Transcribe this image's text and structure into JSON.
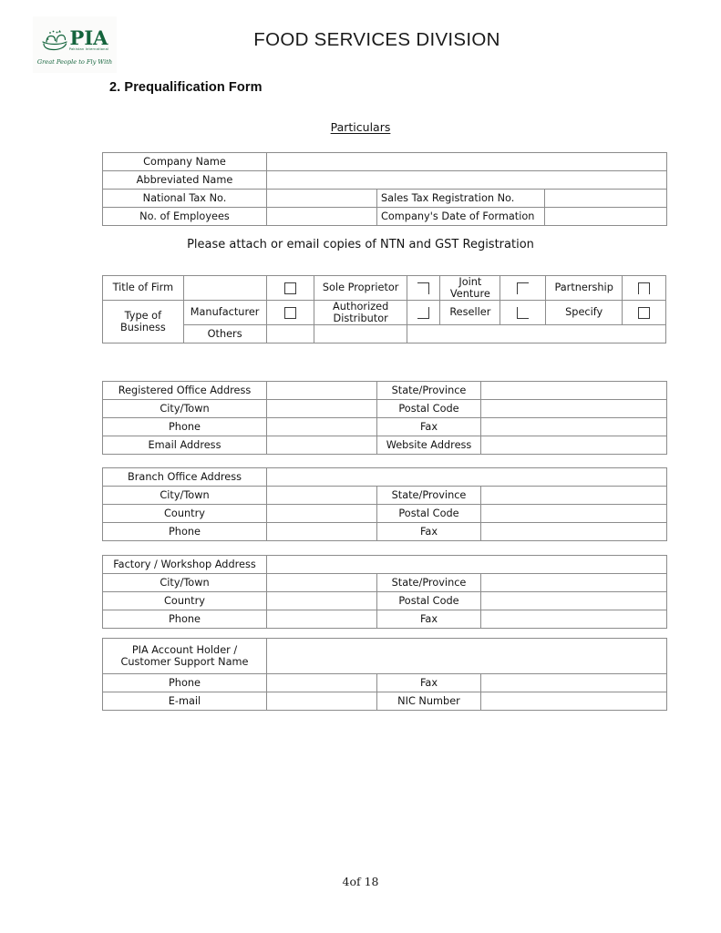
{
  "header": {
    "logo": {
      "brand": "PIA",
      "subtitle": "Pakistan International",
      "tagline": "Great People to Fly With",
      "color": "#14643c"
    },
    "title": "FOOD SERVICES DIVISION"
  },
  "section": {
    "heading": "2. Prequalification Form"
  },
  "captions": {
    "particulars": "Particulars",
    "attach_note": "Please attach or email copies of NTN and GST Registration"
  },
  "particulars_table": {
    "rows": [
      {
        "label": "Company Name",
        "value": "",
        "label2": "",
        "value2": "",
        "full": true
      },
      {
        "label": "Abbreviated Name",
        "value": "",
        "label2": "",
        "value2": "",
        "full": true
      },
      {
        "label": "National Tax No.",
        "value": "",
        "label2": "Sales Tax Registration No.",
        "value2": "",
        "full": false
      },
      {
        "label": "No. of Employees",
        "value": "",
        "label2": "Company's Date of Formation",
        "value2": "",
        "full": false
      }
    ]
  },
  "business_table": {
    "title_of_firm_label": "Title of Firm",
    "title_of_firm_value": "",
    "type_of_business_label": "Type of Business",
    "others_label": "Others",
    "others_value": "",
    "options": [
      {
        "label": "Sole Proprietor",
        "checkbox": "full",
        "checked": false
      },
      {
        "label": "Joint Venture",
        "checkbox": "top-right",
        "checked": false
      },
      {
        "label": "Partnership",
        "checkbox": "top-left-right",
        "checked": false
      },
      {
        "label": "Manufacturer",
        "checkbox": "full",
        "checked": false
      },
      {
        "label": "Authorized Distributor",
        "checkbox": "full",
        "checked": false
      },
      {
        "label": "Reseller",
        "checkbox": "bottom-right",
        "checked": false
      },
      {
        "label": "Specify",
        "checkbox": "top-left",
        "checked": false
      }
    ],
    "firm_first_checkbox": "full",
    "joint_venture_right_checkbox": "top-left",
    "reseller_right_checkbox": "bottom-left",
    "specify_checkbox": "full",
    "partnership_checkbox": "top-left-right",
    "authorized_right_checkbox": "bottom-right"
  },
  "registered_office_table": {
    "rows": [
      {
        "label": "Registered Office Address",
        "value": "",
        "label2": "State/Province",
        "value2": ""
      },
      {
        "label": "City/Town",
        "value": "",
        "label2": "Postal Code",
        "value2": ""
      },
      {
        "label": "Phone",
        "value": "",
        "label2": "Fax",
        "value2": ""
      },
      {
        "label": "Email Address",
        "value": "",
        "label2": "Website Address",
        "value2": ""
      }
    ]
  },
  "branch_office_table": {
    "header_label": "Branch Office Address",
    "header_value": "",
    "rows": [
      {
        "label": "City/Town",
        "value": "",
        "label2": "State/Province",
        "value2": ""
      },
      {
        "label": "Country",
        "value": "",
        "label2": "Postal Code",
        "value2": ""
      },
      {
        "label": "Phone",
        "value": "",
        "label2": "Fax",
        "value2": ""
      }
    ]
  },
  "factory_table": {
    "header_label": "Factory / Workshop Address",
    "header_value": "",
    "rows": [
      {
        "label": "City/Town",
        "value": "",
        "label2": "State/Province",
        "value2": ""
      },
      {
        "label": "Country",
        "value": "",
        "label2": "Postal Code",
        "value2": ""
      },
      {
        "label": "Phone",
        "value": "",
        "label2": "Fax",
        "value2": ""
      }
    ]
  },
  "pia_contact_table": {
    "header_label": "PIA Account Holder / Customer Support Name",
    "header_value": "",
    "rows": [
      {
        "label": "Phone",
        "value": "",
        "label2": "Fax",
        "value2": ""
      },
      {
        "label": "E-mail",
        "value": "",
        "label2": "NIC Number",
        "value2": ""
      }
    ]
  },
  "footer": {
    "page_label": "4of 18"
  }
}
